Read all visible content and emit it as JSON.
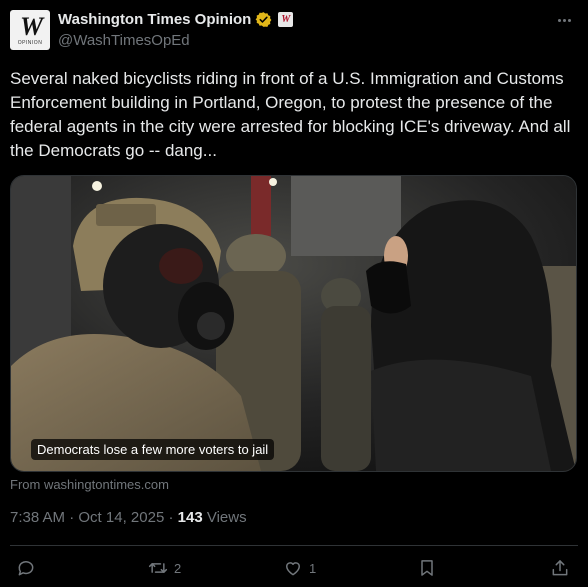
{
  "header": {
    "avatar_mark": "W",
    "avatar_sub": "OPINION",
    "display_name": "Washington Times Opinion",
    "handle": "@WashTimesOpEd",
    "affiliation_badge": "W"
  },
  "post": {
    "text": "Several naked bicyclists riding in front of a U.S. Immigration and Customs Enforcement building in Portland, Oregon, to protest the presence of the federal agents in the city were arrested for blocking ICE's driveway. And all the Democrats go -- dang...",
    "media_caption": "Democrats lose a few more voters to jail",
    "source": "From washingtontimes.com"
  },
  "meta": {
    "time": "7:38 AM",
    "separator": "·",
    "date": "Oct 14, 2025",
    "views_count": "143",
    "views_label": "Views"
  },
  "actions": {
    "reply_count": "",
    "repost_count": "2",
    "like_count": "1"
  },
  "colors": {
    "background": "#000000",
    "text_primary": "#e7e9ea",
    "text_secondary": "#71767b",
    "border": "#2f3336",
    "verified_gold": "#e2b719"
  },
  "icons": [
    "more-icon",
    "verified-icon",
    "reply-icon",
    "repost-icon",
    "like-icon",
    "bookmark-icon",
    "share-icon"
  ]
}
